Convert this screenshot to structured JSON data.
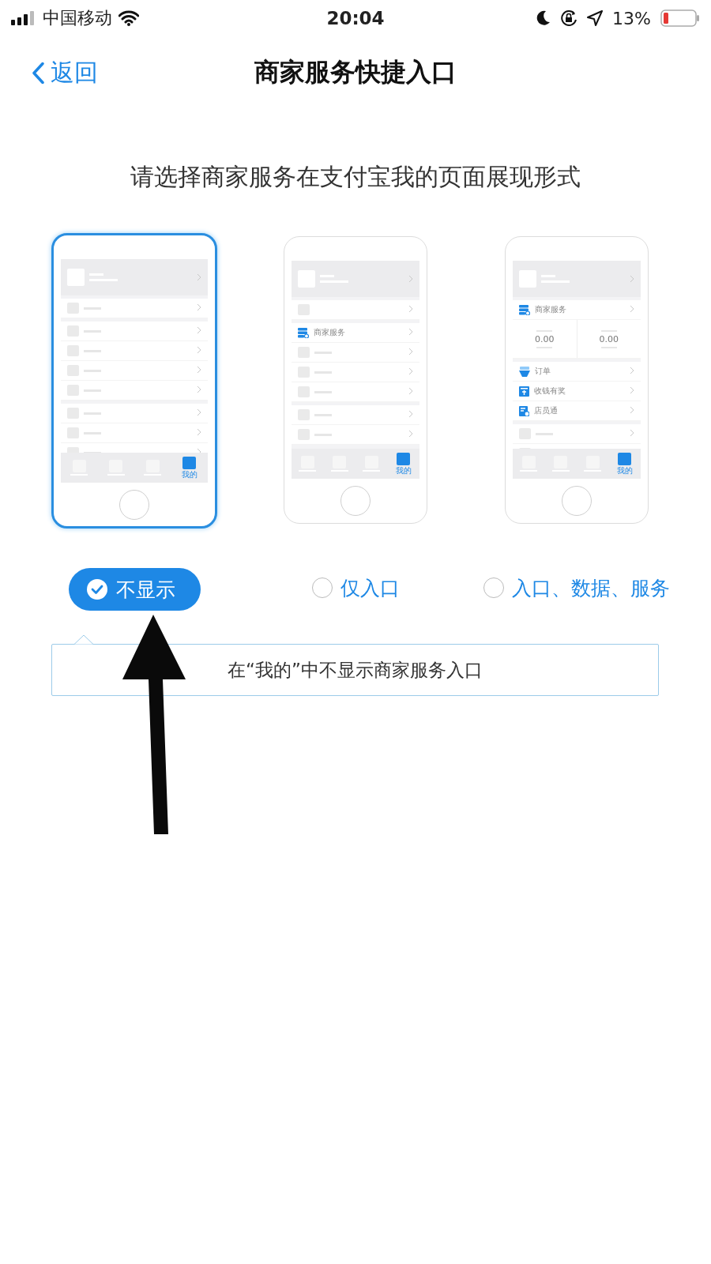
{
  "status_bar": {
    "carrier": "中国移动",
    "time": "20:04",
    "battery": "13%"
  },
  "nav": {
    "back": "返回",
    "title": "商家服务快捷入口"
  },
  "prompt": "请选择商家服务在支付宝我的页面展现形式",
  "options": [
    {
      "label": "不显示",
      "selected": true,
      "preview": {
        "kind": "none",
        "tab_label": "我的"
      }
    },
    {
      "label": "仅入口",
      "selected": false,
      "preview": {
        "kind": "entry",
        "service_label": "商家服务",
        "tab_label": "我的"
      }
    },
    {
      "label": "入口、数据、服务",
      "selected": false,
      "preview": {
        "kind": "full",
        "service_label": "商家服务",
        "stats": [
          "0.00",
          "0.00"
        ],
        "items": [
          "订单",
          "收钱有奖",
          "店员通"
        ],
        "tab_label": "我的"
      }
    }
  ],
  "description": "在“我的”中不显示商家服务入口"
}
